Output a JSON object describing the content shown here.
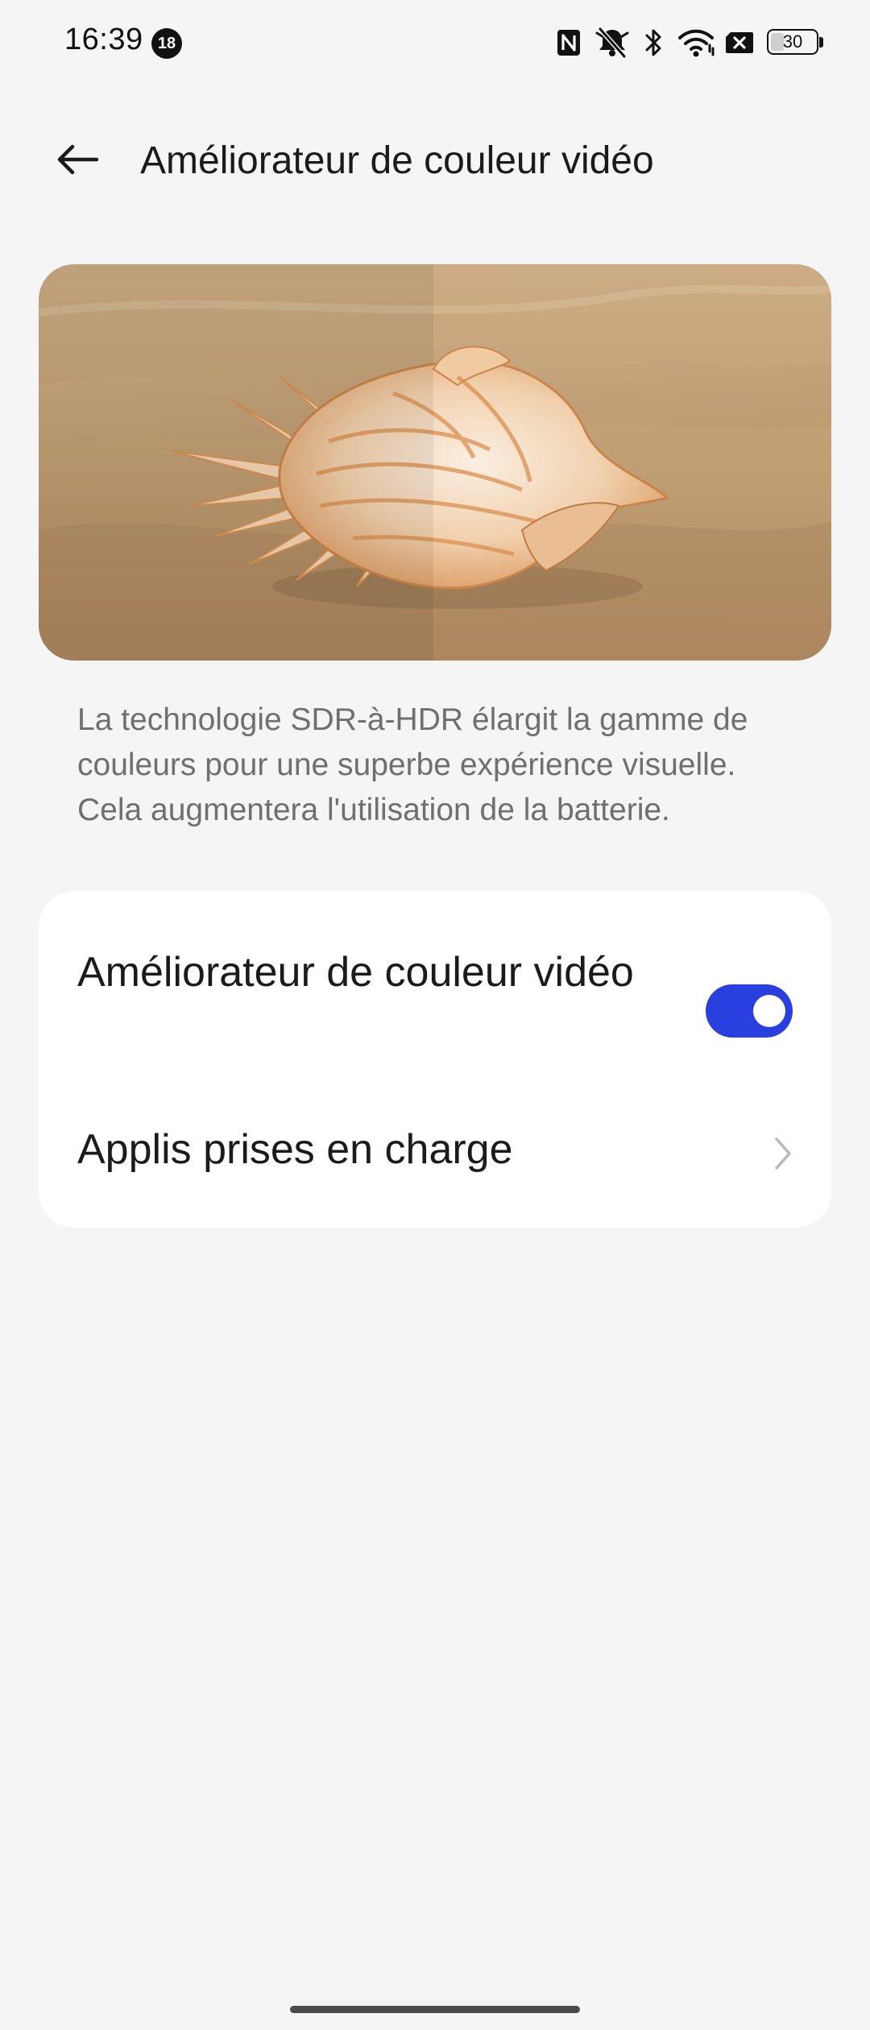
{
  "status_bar": {
    "time": "16:39",
    "notification_count": "18",
    "battery_level": "30",
    "battery_fraction": 0.3,
    "icons": [
      "nfc-icon",
      "silent-mode-icon",
      "bluetooth-icon",
      "wifi-icon",
      "sim-off-icon",
      "battery-icon"
    ]
  },
  "header": {
    "back_icon": "arrow-left-icon",
    "title": "Améliorateur de couleur vidéo"
  },
  "hero_image": {
    "subject": "seashell-on-sand-comparison",
    "split": "before-after"
  },
  "description": "La technologie SDR-à-HDR élargit la gamme de couleurs pour une superbe expérience visuelle. Cela augmentera l'utilisation de la batterie.",
  "settings": {
    "enhancer": {
      "label": "Améliorateur de couleur vidéo",
      "enabled": true
    },
    "supported_apps": {
      "label": "Applis prises en charge",
      "icon": "chevron-right-icon"
    }
  },
  "colors": {
    "accent": "#2a3fe0",
    "background": "#f5f5f5",
    "card": "#ffffff",
    "secondary_text": "#6f6f6f"
  }
}
